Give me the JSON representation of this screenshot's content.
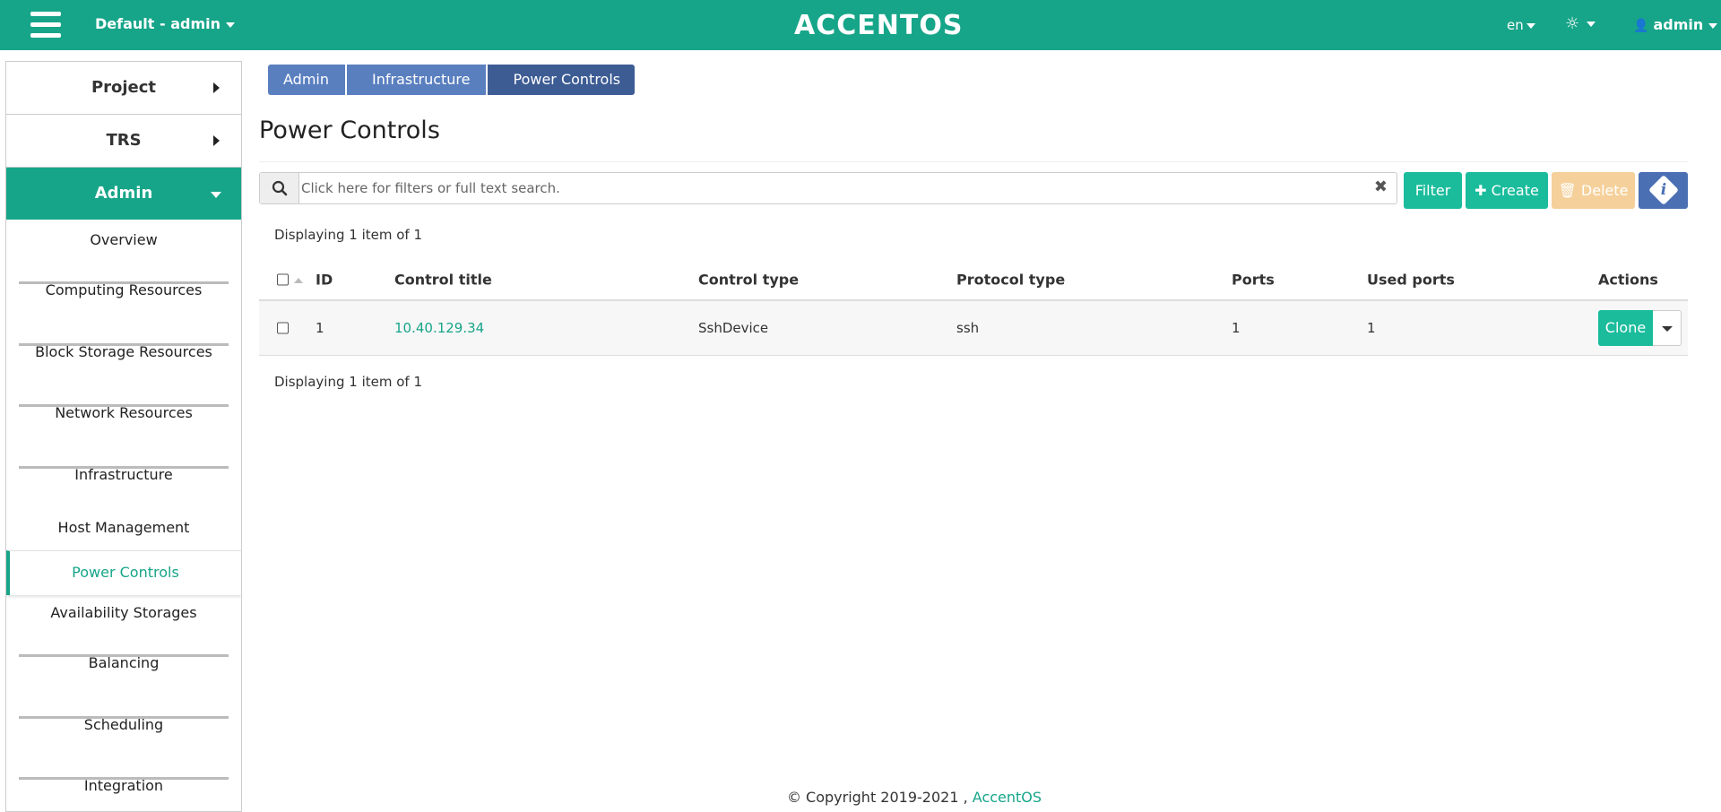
{
  "header": {
    "project_switch": "Default - admin",
    "logo": "ACCENTOS",
    "lang": "en",
    "user": "admin"
  },
  "sidebar": {
    "project": "Project",
    "trs": "TRS",
    "admin": "Admin",
    "items": [
      {
        "label": "Overview"
      },
      {
        "label": "Computing Resources"
      },
      {
        "label": "Block Storage Resources"
      },
      {
        "label": "Network Resources"
      },
      {
        "label": "Infrastructure"
      },
      {
        "label": "Host Management"
      },
      {
        "label": "Power Controls"
      },
      {
        "label": "Availability Storages"
      },
      {
        "label": "Balancing"
      },
      {
        "label": "Scheduling"
      },
      {
        "label": "Integration"
      }
    ]
  },
  "breadcrumb": [
    "Admin",
    "Infrastructure",
    "Power Controls"
  ],
  "page": {
    "title": "Power Controls",
    "search_placeholder": "Click here for filters or full text search.",
    "filter_label": "Filter",
    "create_label": "Create",
    "delete_label": "Delete",
    "count_top": "Displaying 1 item of 1",
    "count_bottom": "Displaying 1 item of 1"
  },
  "table": {
    "columns": [
      "ID",
      "Control title",
      "Control type",
      "Protocol type",
      "Ports",
      "Used ports",
      "Actions"
    ],
    "rows": [
      {
        "id": "1",
        "title": "10.40.129.34",
        "control_type": "SshDevice",
        "protocol": "ssh",
        "ports": "1",
        "used_ports": "1",
        "action": "Clone"
      }
    ]
  },
  "footer": {
    "copyright": "© Copyright 2019-2021 ,",
    "brand": "AccentOS"
  },
  "colors": {
    "brand": "#17a589",
    "button": "#1abc9c",
    "breadcrumb": "#5a7fbf",
    "delete_disabled": "#f5d09a"
  },
  "icons": [
    "menu-icon",
    "caret-down-icon",
    "sun-icon",
    "user-icon",
    "search-icon",
    "close-icon",
    "plus-icon",
    "trash-icon",
    "info-icon"
  ]
}
